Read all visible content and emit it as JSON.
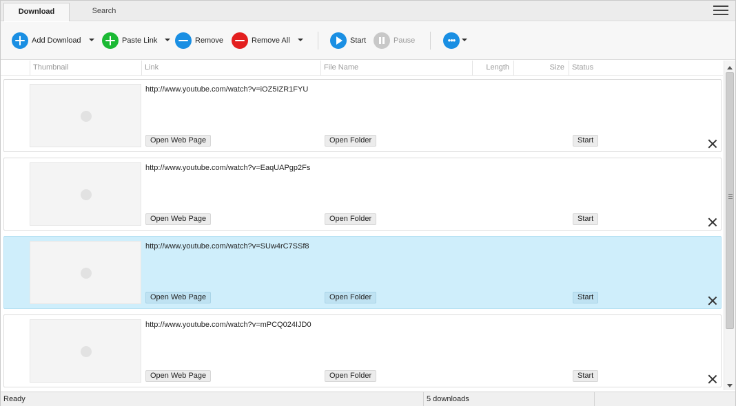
{
  "tabs": [
    {
      "label": "Download",
      "active": true
    },
    {
      "label": "Search",
      "active": false
    }
  ],
  "menu_icon": "hamburger-menu-icon",
  "toolbar": {
    "add_download": {
      "label": "Add Download",
      "icon": "plus-circle-icon",
      "color": "#1a8fe3"
    },
    "paste_link": {
      "label": "Paste Link",
      "icon": "plus-circle-icon",
      "color": "#1bb934"
    },
    "remove": {
      "label": "Remove",
      "icon": "minus-circle-icon",
      "color": "#1a8fe3"
    },
    "remove_all": {
      "label": "Remove All",
      "icon": "minus-circle-icon",
      "color": "#e31f1f"
    },
    "start": {
      "label": "Start",
      "icon": "play-circle-icon",
      "color": "#1a8fe3"
    },
    "pause": {
      "label": "Pause",
      "icon": "pause-circle-icon",
      "color": "#c8c8c8",
      "disabled": true
    },
    "more": {
      "icon": "more-dots-icon",
      "color": "#1a8fe3"
    }
  },
  "columns": [
    "Thumbnail",
    "Link",
    "File Name",
    "Length",
    "Size",
    "Status"
  ],
  "rows": [
    {
      "link": "http://www.youtube.com/watch?v=iOZ5IZR1FYU",
      "open_web_page": "Open Web Page",
      "open_folder": "Open Folder",
      "start": "Start",
      "selected": false
    },
    {
      "link": "http://www.youtube.com/watch?v=EaqUAPgp2Fs",
      "open_web_page": "Open Web Page",
      "open_folder": "Open Folder",
      "start": "Start",
      "selected": false
    },
    {
      "link": "http://www.youtube.com/watch?v=SUw4rC7SSf8",
      "open_web_page": "Open Web Page",
      "open_folder": "Open Folder",
      "start": "Start",
      "selected": true
    },
    {
      "link": "http://www.youtube.com/watch?v=mPCQ024IJD0",
      "open_web_page": "Open Web Page",
      "open_folder": "Open Folder",
      "start": "Start",
      "selected": false
    }
  ],
  "status": {
    "left": "Ready",
    "middle": "5 downloads"
  },
  "colors": {
    "selected_row": "#cfeefb",
    "accent": "#1a8fe3"
  }
}
